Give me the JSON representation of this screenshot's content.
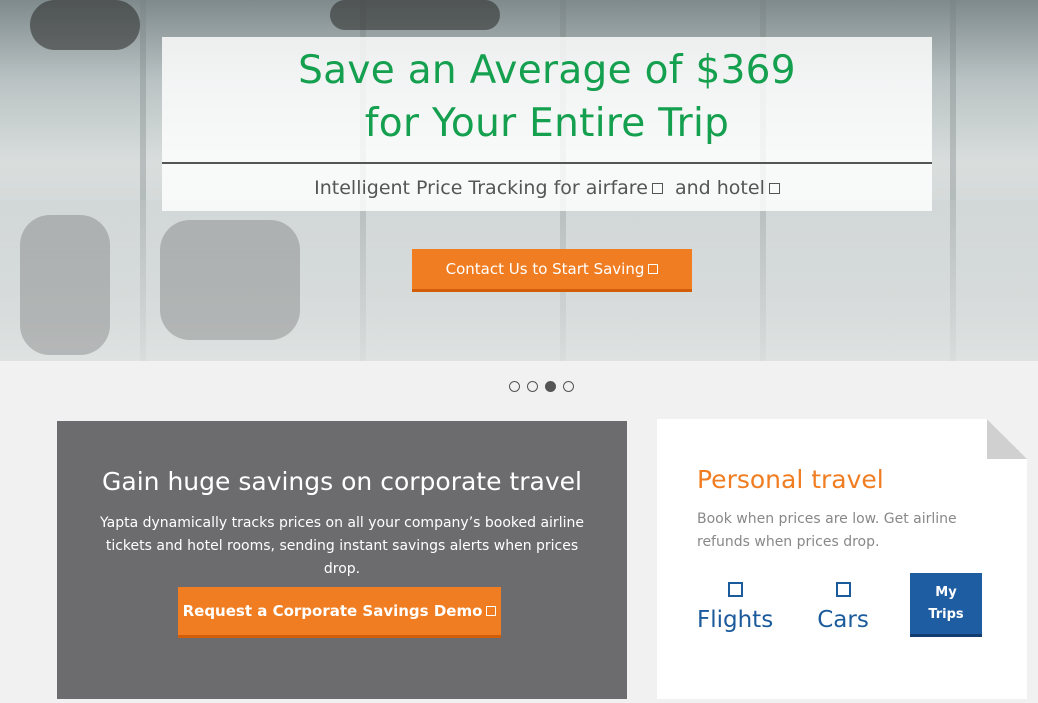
{
  "hero": {
    "title_line1": "Save an Average of $369",
    "title_line2": "for Your Entire Trip",
    "subtitle_text1": "Intelligent Price Tracking for airfare",
    "subtitle_text2": "and hotel",
    "cta_label": "Contact Us to Start Saving",
    "title_color": "#14a04f",
    "cta_color": "#f07d21"
  },
  "carousel": {
    "slides": 4,
    "active_index": 3
  },
  "corporate": {
    "heading": "Gain huge savings on corporate travel",
    "description": "Yapta dynamically tracks prices on all your company’s booked airline tickets and hotel rooms, sending instant savings alerts when prices drop.",
    "button_label": "Request a Corporate Savings Demo",
    "panel_color": "#6c6c6e"
  },
  "personal": {
    "heading": "Personal travel",
    "description": "Book when prices are low. Get airline refunds when prices drop.",
    "tabs": [
      {
        "label": "Flights",
        "icon": "flights-icon"
      },
      {
        "label": "Cars",
        "icon": "cars-icon"
      }
    ],
    "my_trips_line1": "My",
    "my_trips_line2": "Trips",
    "accent_color": "#1f5da3"
  }
}
